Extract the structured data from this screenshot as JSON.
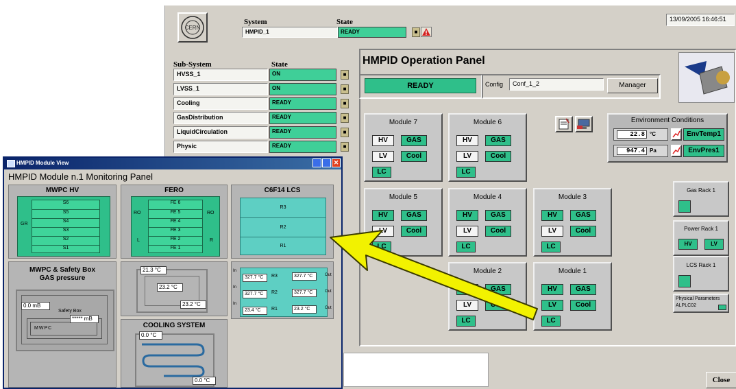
{
  "main": {
    "system_label": "System",
    "state_label": "State",
    "system_value": "HMPID_1",
    "system_state": "READY",
    "datetime": "13/09/2005 16:46:51",
    "logo": "CERN",
    "subsystem_header": "Sub-System",
    "subsystem_state_header": "State",
    "subsystems": [
      {
        "name": "HVSS_1",
        "state": "ON"
      },
      {
        "name": "LVSS_1",
        "state": "ON"
      },
      {
        "name": "Cooling",
        "state": "READY"
      },
      {
        "name": "GasDistribution",
        "state": "READY"
      },
      {
        "name": "LiquidCirculation",
        "state": "READY"
      },
      {
        "name": "Physic",
        "state": "READY"
      }
    ],
    "panel_title": "HMPID Operation Panel",
    "ready_button": "READY",
    "config_label": "Config",
    "config_value": "Conf_1_2",
    "manager_button": "Manager",
    "env_title": "Environment Conditions",
    "env_temp_value": "22.8",
    "env_temp_unit": "°C",
    "env_temp_name": "EnvTemp1",
    "env_pres_value": "947.4",
    "env_pres_unit": "Pa",
    "env_pres_name": "EnvPres1",
    "modules": [
      {
        "title": "Module 7"
      },
      {
        "title": "Module 6"
      },
      {
        "title": "Module 5"
      },
      {
        "title": "Module 4"
      },
      {
        "title": "Module 3"
      },
      {
        "title": "Module 2"
      },
      {
        "title": "Module 1"
      }
    ],
    "btn_hv": "HV",
    "btn_gas": "GAS",
    "btn_lv": "LV",
    "btn_cool": "Cool",
    "btn_lc": "LC",
    "gas_rack": "Gas Rack 1",
    "power_rack": "Power Rack 1",
    "power_hv": "HV",
    "power_lv": "LV",
    "lcs_rack": "LCS Rack 1",
    "phys_params": "Physical Parameters",
    "phys_params_sub": "ALPLC02",
    "close_button": "Close"
  },
  "module_view": {
    "window_title": "HMPID Module View",
    "panel_title": "HMPID Module n.1 Monitoring Panel",
    "hv_title": "MWPC HV",
    "hv_sectors": [
      "S6",
      "S5",
      "S4",
      "S3",
      "S2",
      "S1"
    ],
    "hv_side": "GR",
    "fero_title": "FERO",
    "fero_rows": [
      "FE 6",
      "FE 5",
      "FE 4",
      "FE 3",
      "FE 2",
      "FE 1"
    ],
    "fero_ro": "RO",
    "fero_l": "L",
    "fero_r": "R",
    "lcs_title": "C6F14 LCS",
    "lcs_rows": [
      "R3",
      "R2",
      "R1"
    ],
    "gas_title_1": "MWPC & Safety Box",
    "gas_title_2": "GAS pressure",
    "gas_pressure": "0.0 mB",
    "safety_box": "Safety Box",
    "mwpc_pressure": "***** mB",
    "mwpc_label": "MWPC",
    "fero_temp_1": "21.3 °C",
    "fero_temp_2": "23.2 °C",
    "fero_temp_3": "23.2 °C",
    "cooling_title": "COOLING SYSTEM",
    "cool_in": "0.0 °C",
    "cool_out": "0.0 °C",
    "lcs_in_label": "In",
    "lcs_out_label": "Out",
    "lcs_temps": [
      {
        "r": "R3",
        "in": "327.7 °C",
        "out": "327.7 °C"
      },
      {
        "r": "R2",
        "in": "327.7 °C",
        "out": "327.7 °C"
      },
      {
        "r": "R1",
        "in": "23.4 °C",
        "out": "23.2 °C"
      }
    ]
  },
  "colors": {
    "state_green": "#3fcf98",
    "title_bar": "#0a246a",
    "arrow": "#f2f200"
  }
}
